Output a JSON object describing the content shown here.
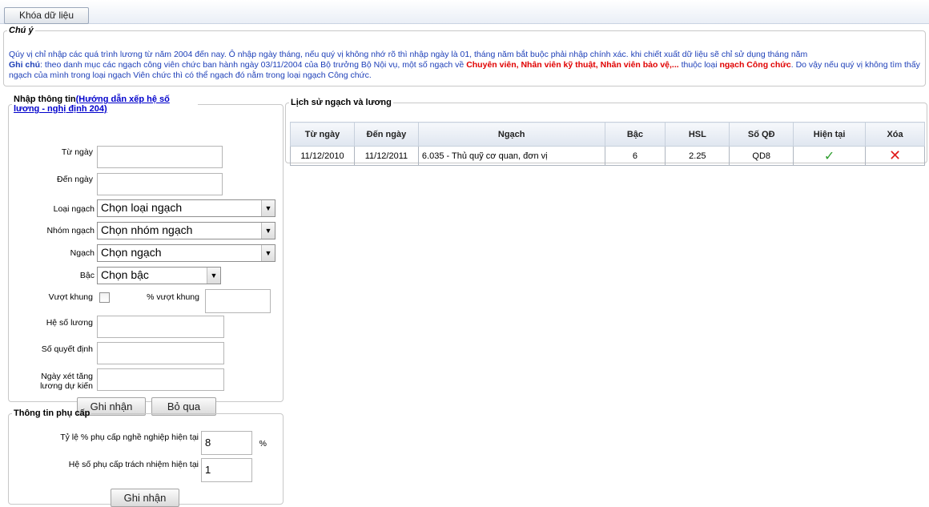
{
  "toolbar": {
    "lock_button": "Khóa dữ liệu"
  },
  "note": {
    "title": "Chú ý",
    "line1": "Qúy vị chỉ nhập các quá trình lương từ năm 2004 đến nay. Ô nhập ngày tháng, nếu quý vị không nhớ rõ thì nhập ngày là 01, tháng năm bắt buộc phải nhập chính xác. khi chiết xuất dữ liệu sẽ chỉ sử dụng tháng năm",
    "ghi_chu_label": "Ghi chú",
    "line2_a": ": theo danh mục các ngạch công viên chức ban hành ngày 03/11/2004 của Bộ trưởng Bộ Nội vụ, một số ngạch về ",
    "line2_red1": "Chuyên viên, Nhân viên kỹ thuật, Nhân viên bảo vệ,...",
    "line2_b": " thuộc loại ",
    "line2_red2": "ngạch Công chức",
    "line2_c": ". Do vậy nếu quý vị không tìm thấy ngạch của mình trong loại ngạch Viên chức thì có thể ngạch đó nằm trong loại ngạch Công chức."
  },
  "input_form": {
    "legend_prefix": "Nhập thông tin",
    "guide_link": "(Hướng dẫn xếp hệ số lương - nghị định 204)",
    "from_date_label": "Từ ngày",
    "to_date_label": "Đến ngày",
    "rank_type_label": "Loại ngạch",
    "rank_type_value": "Chọn loại ngạch",
    "rank_group_label": "Nhóm ngạch",
    "rank_group_value": "Chọn nhóm ngạch",
    "rank_label": "Ngạch",
    "rank_value": "Chọn ngạch",
    "step_label": "Bậc",
    "step_value": "Chọn bậc",
    "over_frame_label": "Vượt khung",
    "over_frame_pct_label": "% vượt khung",
    "salary_coef_label": "Hệ số lương",
    "decision_no_label": "Số quyết định",
    "expected_raise_label": "Ngày xét tăng lương dự kiến",
    "save_button": "Ghi nhận",
    "skip_button": "Bỏ qua"
  },
  "allowance": {
    "title": "Thông tin phụ cấp",
    "pct_label": "Tỷ lệ % phụ cấp nghề nghiệp hiện tại",
    "pct_value": "8",
    "pct_unit": "%",
    "resp_label": "Hệ số phụ cấp trách nhiệm hiện tại",
    "resp_value": "1",
    "save_button": "Ghi nhận"
  },
  "history": {
    "title": "Lịch sử ngạch và lương",
    "columns": [
      "Từ ngày",
      "Đến ngày",
      "Ngạch",
      "Bậc",
      "HSL",
      "Số QĐ",
      "Hiện tại",
      "Xóa"
    ],
    "rows": [
      {
        "from": "11/12/2010",
        "to": "11/12/2011",
        "rank": "6.035 - Thủ quỹ cơ quan, đơn vị",
        "step": "6",
        "hsl": "2.25",
        "decision": "QD8",
        "current_icon": "check-icon",
        "delete_icon": "x-icon"
      }
    ]
  },
  "colors": {
    "note_blue": "#1d3fb8",
    "note_red": "#e00000",
    "check_green": "#2e9e2e",
    "delete_red": "#e01b1b"
  }
}
